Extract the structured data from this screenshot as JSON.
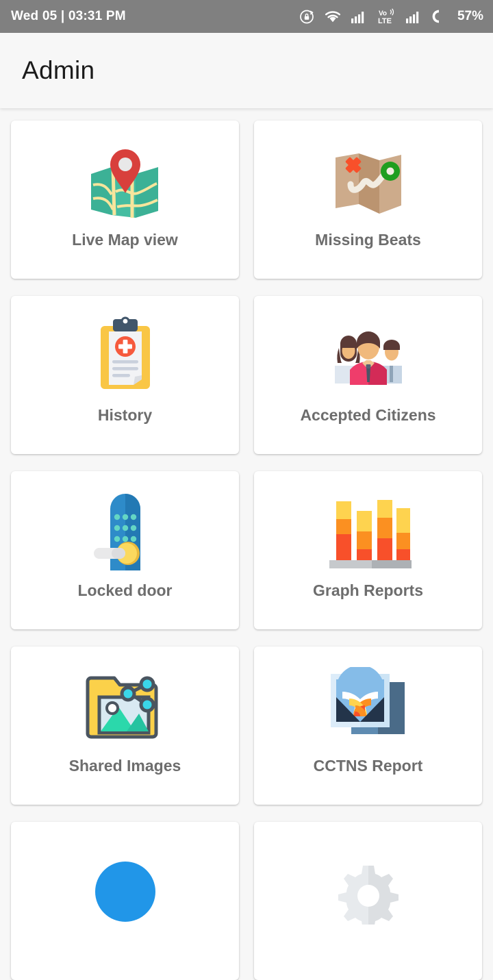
{
  "statusbar": {
    "datetime": "Wed 05 | 03:31 PM",
    "battery_percent": "57%",
    "icons": [
      "rotation-lock-icon",
      "wifi-icon",
      "signal-bars-icon",
      "volte-icon",
      "signal-bars-2-icon",
      "battery-icon"
    ],
    "volte_top": "Vo",
    "volte_bottom": "LTE",
    "background": "#808080"
  },
  "appbar": {
    "title": "Admin",
    "background": "#f7f7f7"
  },
  "grid": {
    "cards": [
      {
        "label": "Live Map view",
        "icon": "map-pin-icon"
      },
      {
        "label": "Missing Beats",
        "icon": "map-route-icon"
      },
      {
        "label": "History",
        "icon": "clipboard-medical-icon"
      },
      {
        "label": "Accepted Citizens",
        "icon": "people-group-icon"
      },
      {
        "label": "Locked door",
        "icon": "keypad-door-lock-icon"
      },
      {
        "label": "Graph Reports",
        "icon": "bar-chart-icon"
      },
      {
        "label": "Shared Images",
        "icon": "shared-folder-image-icon"
      },
      {
        "label": "CCTNS Report",
        "icon": "photo-stack-icon"
      },
      {
        "label": "",
        "icon": "blue-circle-icon"
      },
      {
        "label": "",
        "icon": "gear-icon"
      }
    ]
  },
  "colors": {
    "page_background": "#f7f7f7",
    "card_background": "#ffffff",
    "label_text": "#6d6d6d",
    "title_text": "#1b1b1b",
    "statusbar_background": "#808080",
    "map_teal": "#3cb196",
    "map_road": "#f7e59c",
    "pin_red": "#d8403c",
    "missing_map_tan": "#c9a687",
    "marker_green": "#1f9e1f",
    "x_orange": "#f8502a",
    "clipboard_yellow": "#f9c council",
    "lock_blue": "#2e8bc9",
    "bar_red": "#f8502a",
    "bar_orange": "#fb9021",
    "bar_yellow": "#fed34f",
    "folder_yellow": "#fbd14a",
    "share_cyan": "#3ad6e8",
    "photo_navy": "#23344a"
  }
}
